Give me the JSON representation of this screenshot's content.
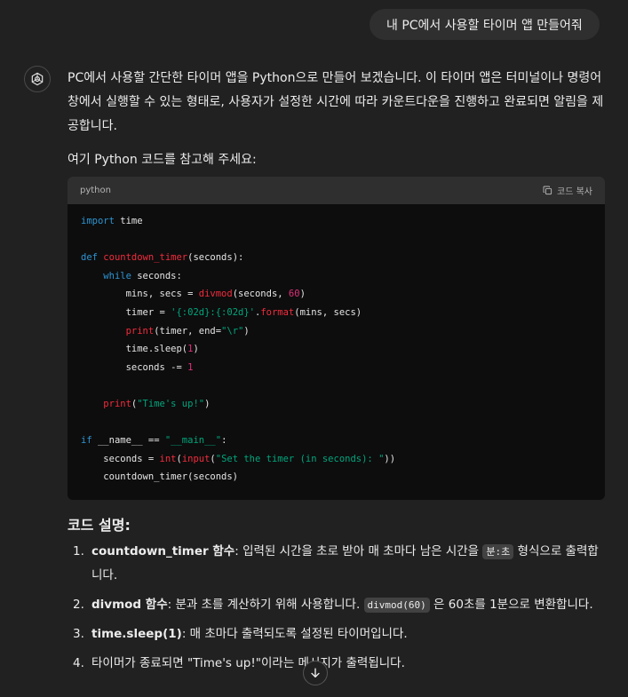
{
  "user_message": "내 PC에서 사용할 타이머 앱 만들어줘",
  "assistant": {
    "intro": "PC에서 사용할 간단한 타이머 앱을 Python으로 만들어 보겠습니다. 이 타이머 앱은 터미널이나 명령어 창에서 실행할 수 있는 형태로, 사용자가 설정한 시간에 따라 카운트다운을 진행하고 완료되면 알림을 제공합니다.",
    "lead": "여기 Python 코드를 참고해 주세요:",
    "code_block": {
      "language": "python",
      "copy_label": "코드 복사",
      "lines": [
        [
          {
            "t": "import",
            "c": "kw"
          },
          {
            "t": " time"
          }
        ],
        [],
        [
          {
            "t": "def",
            "c": "kw"
          },
          {
            "t": " "
          },
          {
            "t": "countdown_timer",
            "c": "fn"
          },
          {
            "t": "(seconds):"
          }
        ],
        [
          {
            "t": "    "
          },
          {
            "t": "while",
            "c": "kw"
          },
          {
            "t": " seconds:"
          }
        ],
        [
          {
            "t": "        mins, secs = "
          },
          {
            "t": "divmod",
            "c": "fn"
          },
          {
            "t": "(seconds, "
          },
          {
            "t": "60",
            "c": "num"
          },
          {
            "t": ")"
          }
        ],
        [
          {
            "t": "        timer = "
          },
          {
            "t": "'{:02d}:{:02d}'",
            "c": "str"
          },
          {
            "t": "."
          },
          {
            "t": "format",
            "c": "fn"
          },
          {
            "t": "(mins, secs)"
          }
        ],
        [
          {
            "t": "        "
          },
          {
            "t": "print",
            "c": "fn"
          },
          {
            "t": "(timer, end="
          },
          {
            "t": "\"\\r\"",
            "c": "str"
          },
          {
            "t": ")"
          }
        ],
        [
          {
            "t": "        time.sleep("
          },
          {
            "t": "1",
            "c": "num"
          },
          {
            "t": ")"
          }
        ],
        [
          {
            "t": "        seconds -= "
          },
          {
            "t": "1",
            "c": "num"
          }
        ],
        [],
        [
          {
            "t": "    "
          },
          {
            "t": "print",
            "c": "fn"
          },
          {
            "t": "("
          },
          {
            "t": "\"Time's up!\"",
            "c": "str"
          },
          {
            "t": ")"
          }
        ],
        [],
        [
          {
            "t": "if",
            "c": "kw"
          },
          {
            "t": " __name__ == "
          },
          {
            "t": "\"__main__\"",
            "c": "str"
          },
          {
            "t": ":"
          }
        ],
        [
          {
            "t": "    seconds = "
          },
          {
            "t": "int",
            "c": "fn"
          },
          {
            "t": "("
          },
          {
            "t": "input",
            "c": "fn"
          },
          {
            "t": "("
          },
          {
            "t": "\"Set the timer (in seconds): \"",
            "c": "str"
          },
          {
            "t": "))"
          }
        ],
        [
          {
            "t": "    countdown_timer(seconds)"
          }
        ]
      ]
    },
    "explanation_heading": "코드 설명:",
    "explanation_items": [
      {
        "num": "1.",
        "bold": "countdown_timer 함수",
        "text": ": 입력된 시간을 초로 받아 매 초마다 남은 시간을 ",
        "code": "분:초",
        "after": " 형식으로 출력합니다."
      },
      {
        "num": "2.",
        "bold": "divmod 함수",
        "text": ": 분과 초를 계산하기 위해 사용합니다. ",
        "code": "divmod(60)",
        "after": " 은 60초를 1분으로 변환합니다."
      },
      {
        "num": "3.",
        "bold": "time.sleep(1)",
        "text": ": 매 초마다 출력되도록 설정된 타이머입니다.",
        "code": "",
        "after": ""
      },
      {
        "num": "4.",
        "bold": "",
        "text": "타이머가 종료되면 \"Time's up!\"이라는 메시지가 출력됩니다.",
        "code": "",
        "after": ""
      }
    ]
  },
  "icons": {
    "avatar": "openai-logo-icon",
    "copy": "copy-icon",
    "scroll": "arrow-down-icon"
  },
  "colors": {
    "background": "#212121",
    "user_bubble": "#2f2f2f",
    "code_bg": "#0d0d0d",
    "keyword": "#2e95d3",
    "function": "#f22c3d",
    "string": "#00a67d",
    "number": "#df3079"
  }
}
